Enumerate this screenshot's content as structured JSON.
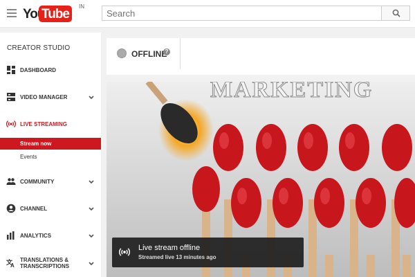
{
  "header": {
    "logo_you": "You",
    "logo_tube": "Tube",
    "logo_region": "IN",
    "search_placeholder": "Search"
  },
  "sidebar": {
    "title": "CREATOR STUDIO",
    "items": [
      {
        "label": "DASHBOARD",
        "icon": "dashboard-icon"
      },
      {
        "label": "VIDEO MANAGER",
        "icon": "video-manager-icon"
      },
      {
        "label": "LIVE STREAMING",
        "icon": "live-broadcast-icon",
        "active": true
      },
      {
        "label": "COMMUNITY",
        "icon": "community-icon"
      },
      {
        "label": "CHANNEL",
        "icon": "channel-icon"
      },
      {
        "label": "ANALYTICS",
        "icon": "analytics-icon"
      },
      {
        "label": "TRANSLATIONS &",
        "label2": "TRANSCRIPTIONS",
        "icon": "translate-icon"
      }
    ],
    "subitems": [
      {
        "label": "Stream now",
        "selected": true
      },
      {
        "label": "Events"
      }
    ]
  },
  "stream": {
    "status": "OFFLINE",
    "help": "?"
  },
  "video": {
    "image_text": "MARKETING",
    "overlay_title": "Live stream offline",
    "overlay_subtitle": "Streamed live 13 minutes ago"
  },
  "colors": {
    "brand_red": "#e62117",
    "active_red": "#cc181e"
  }
}
